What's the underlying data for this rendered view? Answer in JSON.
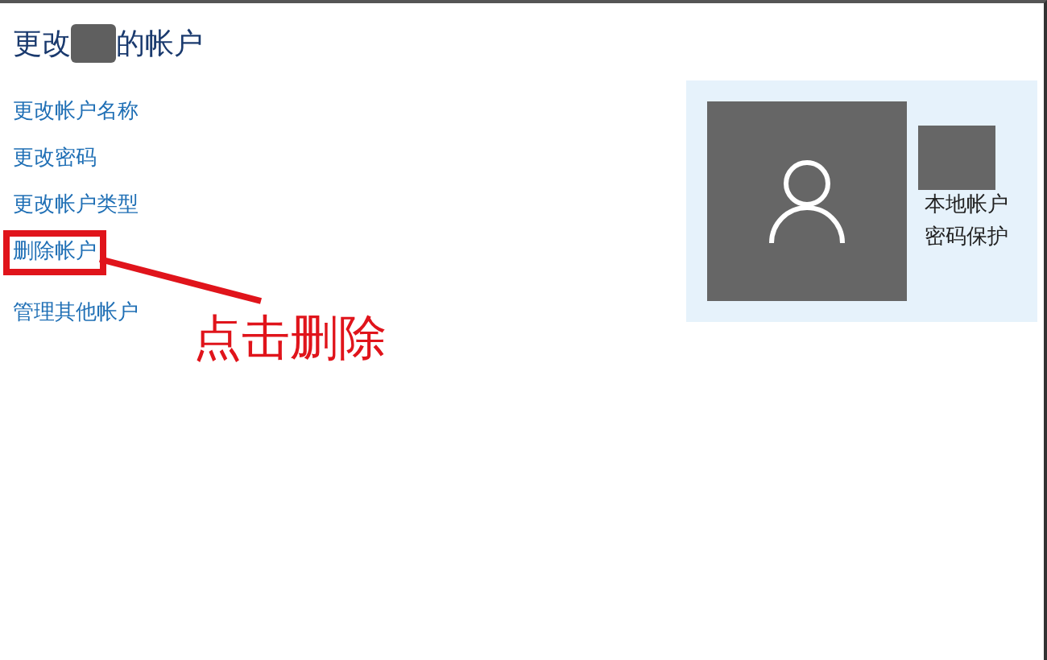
{
  "title": {
    "prefix": "更改",
    "suffix": "的帐户",
    "redacted": true
  },
  "links": [
    {
      "label": "更改帐户名称",
      "highlighted": false
    },
    {
      "label": "更改密码",
      "highlighted": false
    },
    {
      "label": "更改帐户类型",
      "highlighted": false
    },
    {
      "label": "删除帐户",
      "highlighted": true
    },
    {
      "label": "管理其他帐户",
      "highlighted": false
    }
  ],
  "account_card": {
    "name_redacted": true,
    "lines": [
      "本地帐户",
      "密码保护"
    ]
  },
  "annotation": {
    "text": "点击删除"
  }
}
